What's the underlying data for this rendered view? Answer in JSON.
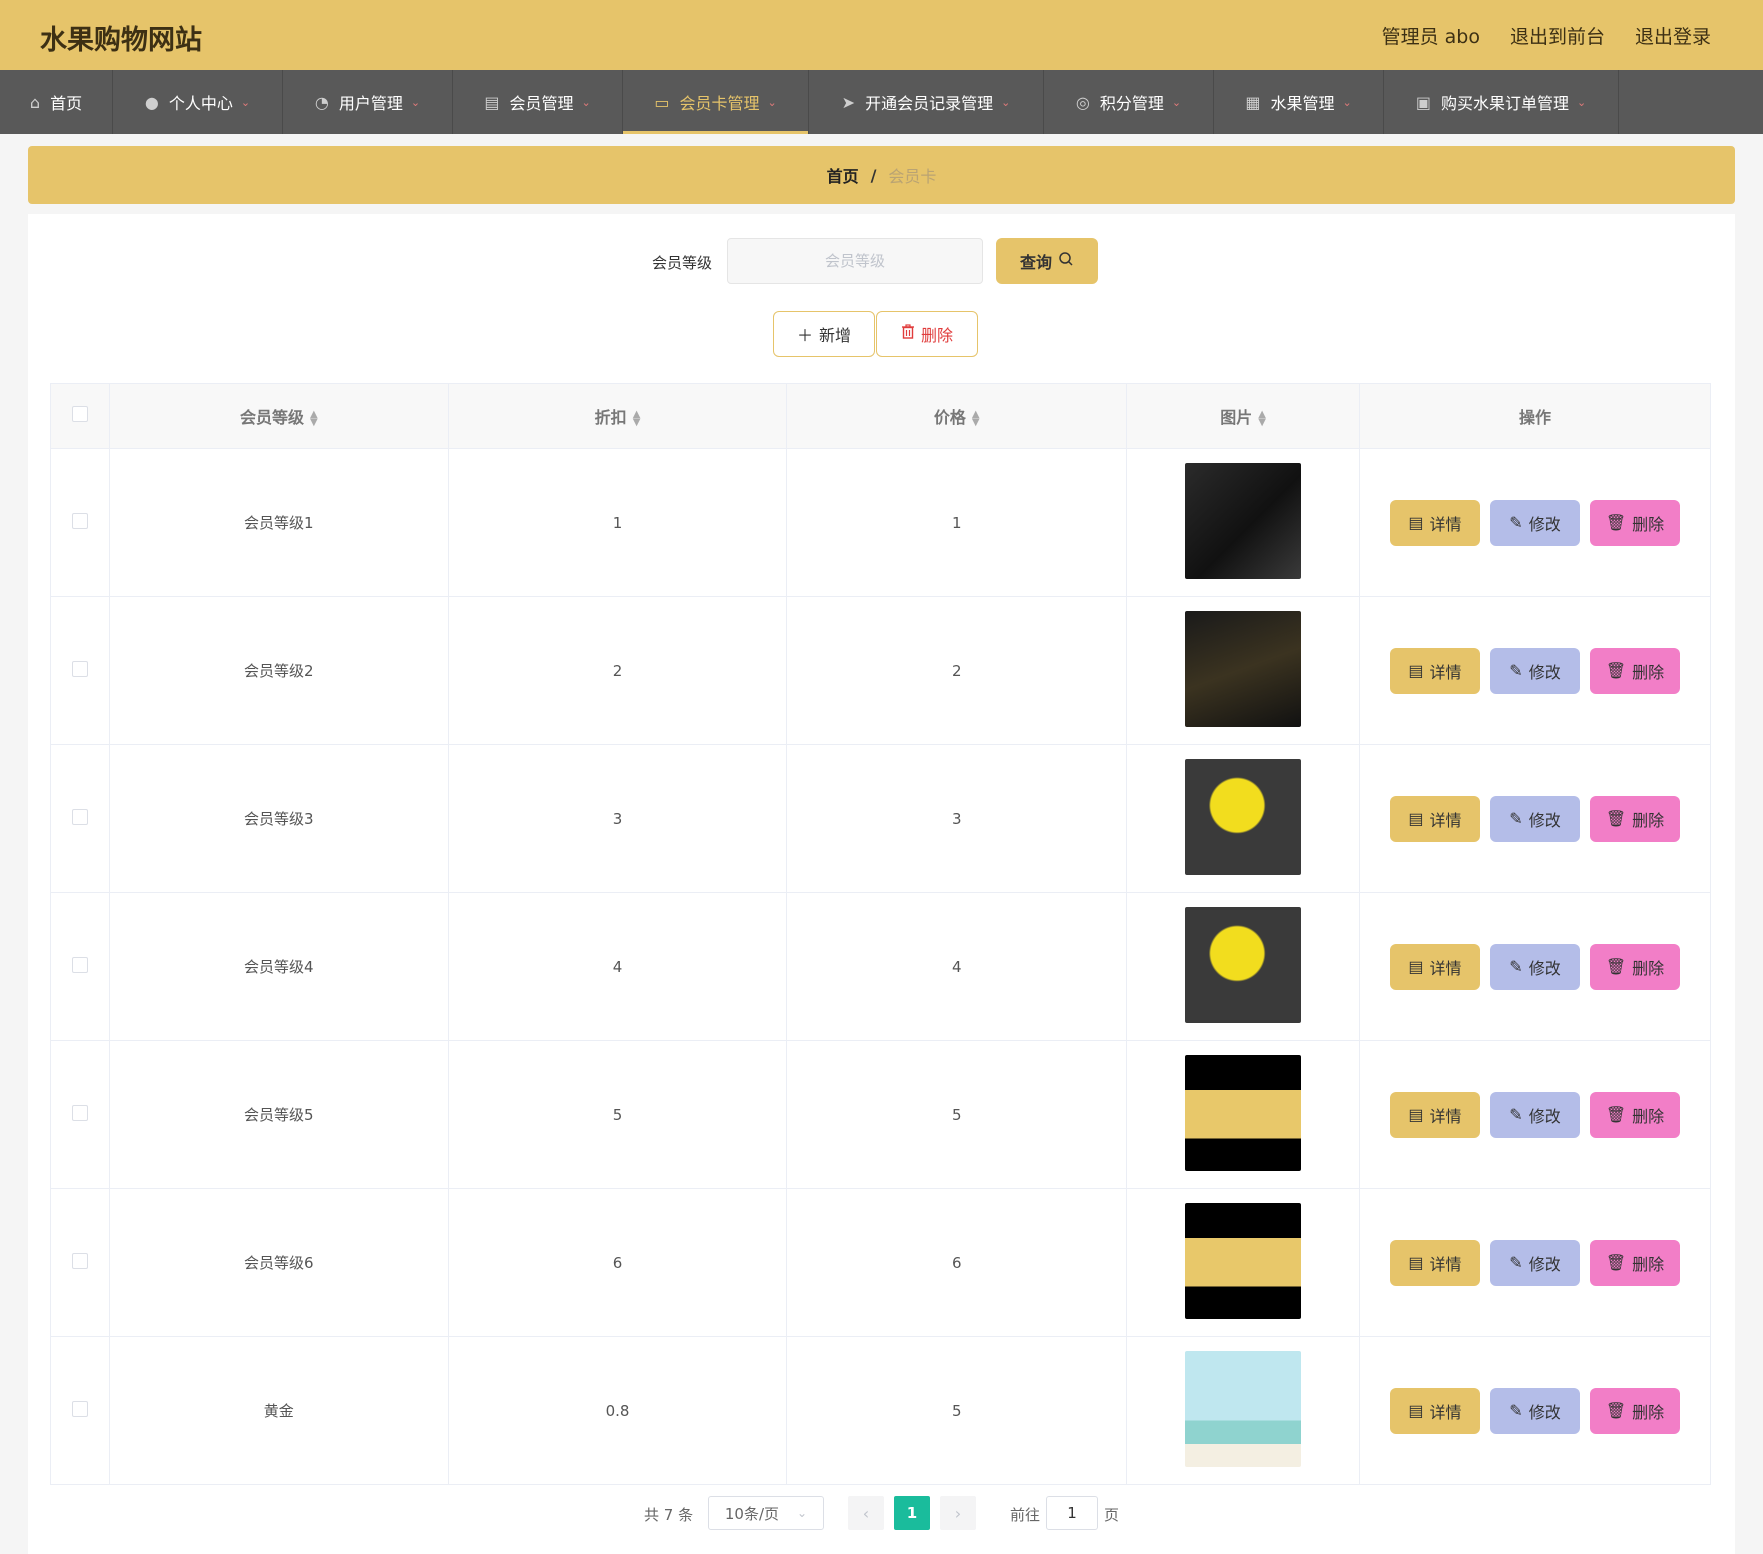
{
  "header": {
    "brand": "水果购物网站",
    "admin": "管理员 abo",
    "back_front": "退出到前台",
    "logout": "退出登录"
  },
  "nav": [
    {
      "label": "首页",
      "icon": "home-icon"
    },
    {
      "label": "个人中心",
      "icon": "user-icon"
    },
    {
      "label": "用户管理",
      "icon": "dashboard-icon"
    },
    {
      "label": "会员管理",
      "icon": "clipboard-icon"
    },
    {
      "label": "会员卡管理",
      "icon": "chat-icon"
    },
    {
      "label": "开通会员记录管理",
      "icon": "send-icon"
    },
    {
      "label": "积分管理",
      "icon": "target-icon"
    },
    {
      "label": "水果管理",
      "icon": "grid-icon"
    },
    {
      "label": "购买水果订单管理",
      "icon": "briefcase-icon"
    }
  ],
  "breadcrumb": {
    "home": "首页",
    "sep": "/",
    "current": "会员卡"
  },
  "search": {
    "label": "会员等级",
    "placeholder": "会员等级",
    "button": "查询"
  },
  "actions": {
    "add": "新增",
    "delete": "删除"
  },
  "table": {
    "headers": [
      "会员等级",
      "折扣",
      "价格",
      "图片",
      "操作"
    ],
    "rows": [
      {
        "level": "会员等级1",
        "discount": "1",
        "price": "1"
      },
      {
        "level": "会员等级2",
        "discount": "2",
        "price": "2"
      },
      {
        "level": "会员等级3",
        "discount": "3",
        "price": "3"
      },
      {
        "level": "会员等级4",
        "discount": "4",
        "price": "4"
      },
      {
        "level": "会员等级5",
        "discount": "5",
        "price": "5"
      },
      {
        "level": "会员等级6",
        "discount": "6",
        "price": "6"
      },
      {
        "level": "黄金",
        "discount": "0.8",
        "price": "5"
      }
    ],
    "op_detail": "详情",
    "op_edit": "修改",
    "op_delete": "删除"
  },
  "pager": {
    "total": "共 7 条",
    "size": "10条/页",
    "page": "1",
    "goto": "前往",
    "goto_value": "1",
    "unit": "页"
  }
}
